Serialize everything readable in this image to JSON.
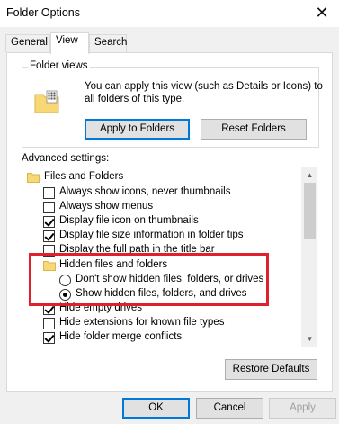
{
  "window": {
    "title": "Folder Options",
    "close_glyph": "✕"
  },
  "tabs": [
    {
      "label": "General",
      "active": false
    },
    {
      "label": "View",
      "active": true
    },
    {
      "label": "Search",
      "active": false
    }
  ],
  "folder_views": {
    "legend": "Folder views",
    "description": "You can apply this view (such as Details or Icons) to all folders of this type.",
    "apply_button": "Apply to Folders",
    "reset_button": "Reset Folders"
  },
  "advanced": {
    "label": "Advanced settings:",
    "items": [
      {
        "type": "folder",
        "indent": 0,
        "label": "Files and Folders"
      },
      {
        "type": "checkbox",
        "indent": 1,
        "label": "Always show icons, never thumbnails",
        "checked": false
      },
      {
        "type": "checkbox",
        "indent": 1,
        "label": "Always show menus",
        "checked": false
      },
      {
        "type": "checkbox",
        "indent": 1,
        "label": "Display file icon on thumbnails",
        "checked": true
      },
      {
        "type": "checkbox",
        "indent": 1,
        "label": "Display file size information in folder tips",
        "checked": true
      },
      {
        "type": "checkbox",
        "indent": 1,
        "label": "Display the full path in the title bar",
        "checked": false
      },
      {
        "type": "folder",
        "indent": 1,
        "label": "Hidden files and folders"
      },
      {
        "type": "radio",
        "indent": 2,
        "label": "Don't show hidden files, folders, or drives",
        "checked": false
      },
      {
        "type": "radio",
        "indent": 2,
        "label": "Show hidden files, folders, and drives",
        "checked": true
      },
      {
        "type": "checkbox",
        "indent": 1,
        "label": "Hide empty drives",
        "checked": true
      },
      {
        "type": "checkbox",
        "indent": 1,
        "label": "Hide extensions for known file types",
        "checked": false
      },
      {
        "type": "checkbox",
        "indent": 1,
        "label": "Hide folder merge conflicts",
        "checked": true
      }
    ],
    "restore_button": "Restore Defaults"
  },
  "footer": {
    "ok": "OK",
    "cancel": "Cancel",
    "apply": "Apply"
  },
  "colors": {
    "highlight": "#e0202d",
    "folder": "#f8d775",
    "default_button_border": "#0078d7"
  }
}
